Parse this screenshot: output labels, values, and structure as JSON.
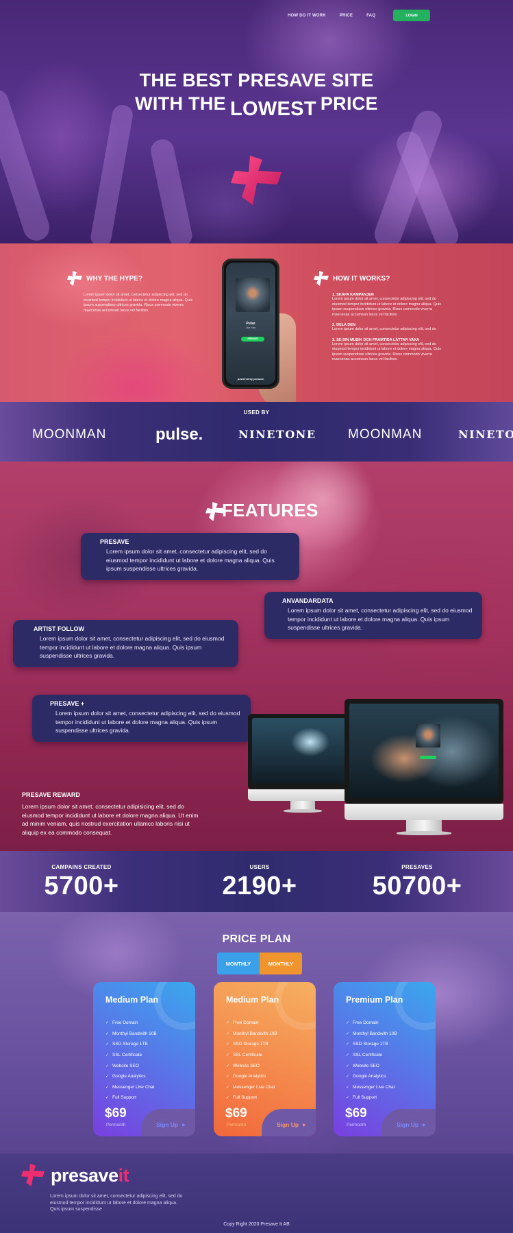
{
  "nav": {
    "links": [
      "HOW DO IT WORK",
      "PRICE",
      "FAQ"
    ],
    "login": "LOGIN"
  },
  "hero": {
    "line1": "THE BEST PRESAVE SITE",
    "line2_a": "WITH THE",
    "line2_b": "LOWEST",
    "line2_c": "PRICE"
  },
  "hype": {
    "title": "WHY THE HYPE?",
    "text": "Lorem ipsum dolor sit amet, consectetur adipiscing elit, sed do eiusmod tempor incididunt ut labore et dolore magna aliqua. Quis ipsum suspendisse ultrices gravida. Risus commodo viverra maecenas accumsan lacus vel facilisis."
  },
  "phone": {
    "artist": "Pulse",
    "subtitle": "Live Now",
    "button": "PRESAVE",
    "footer": "powered by presave"
  },
  "how": {
    "title": "HOW IT WORKS?",
    "steps": [
      {
        "title": "1. SKAPA KAMPANJEN",
        "text": "Lorem ipsum dolor sit amet, consectetur adipiscing elit, sed do eiusmod tempor incididunt ut labore et dolore magna aliqua. Quis ipsum suspendisse ultrices gravida. Risus commodo viverra maecenas accumsan lacus vel facilisis."
      },
      {
        "title": "2. DELA DEN",
        "text": "Lorem ipsum dolor sit amet, consectetur adipiscing elit, sed do"
      },
      {
        "title": "3. SE DIN MUSIK OCH FRAMTIDA LÅTTAR VAXA",
        "text": "Lorem ipsum dolor sit amet, consectetur adipiscing elit, sed do eiusmod tempor incididunt ut labore et dolore magna aliqua. Quis ipsum suspendisse ultrices gravida. Risus commodo viverra maecenas accumsan lacus vel facilisis."
      }
    ]
  },
  "usedby": {
    "title": "USED BY",
    "logos": [
      "MOONMAN",
      "pulse.",
      "NINETONE",
      "MOONMAN",
      "NINETO"
    ]
  },
  "features": {
    "title": "FEATURES",
    "cards": [
      {
        "title": "PRESAVE",
        "text": "Lorem ipsum dolor sit amet, consectetur adipiscing elit, sed do eiusmod tempor incididunt ut labore et dolore magna aliqua. Quis ipsum suspendisse ultrices gravida."
      },
      {
        "title": "ANVANDARDATA",
        "text": "Lorem ipsum dolor sit amet, consectetur adipiscing elit, sed do eiusmod tempor incididunt ut labore et dolore magna aliqua. Quis ipsum suspendisse ultrices gravida."
      },
      {
        "title": "ARTIST FOLLOW",
        "text": "Lorem ipsum dolor sit amet, consectetur adipiscing elit, sed do eiusmod tempor incididunt ut labore et dolore magna aliqua. Quis ipsum suspendisse ultrices gravida."
      },
      {
        "title": "PRESAVE +",
        "text": "Lorem ipsum dolor sit amet, consectetur adipiscing elit, sed do eiusmod tempor incididunt ut labore et dolore magna aliqua. Quis ipsum suspendisse ultrices gravida."
      }
    ],
    "reward_title": "PRESAVE REWARD",
    "reward_text": "Lorem ipsum dolor sit amet, consectetur adipisicing elit, sed do eiusmod tempor incididunt ut labore et dolore magna aliqua. Ut enim ad minim veniam, quis nostrud exercitation ullamco laboris nisi ut aliquip ex ea commodo consequat."
  },
  "stats": [
    {
      "label": "CAMPAINS CREATED",
      "value": "5700+"
    },
    {
      "label": "USERS",
      "value": "2190+"
    },
    {
      "label": "PRESAVES",
      "value": "50700+"
    }
  ],
  "pricing": {
    "title": "PRICE PLAN",
    "toggle": [
      "MONTHLY",
      "MONTHLY"
    ],
    "plans": [
      {
        "name": "Medium Plan",
        "price": "$69",
        "per": "Permonth",
        "signup": "Sign Up",
        "color_from": "#3aa8ee",
        "color_to": "#7a3fe0",
        "accent": "#7a5af0"
      },
      {
        "name": "Medium Plan",
        "price": "$69",
        "per": "Permonth",
        "signup": "Sign Up",
        "color_from": "#f2683c",
        "color_to": "#f6b060",
        "accent": "#f08a5a"
      },
      {
        "name": "Premium Plan",
        "price": "$69",
        "per": "Permonth",
        "signup": "Sign Up",
        "color_from": "#3aa8ee",
        "color_to": "#7a3fe0",
        "accent": "#7a5af0"
      }
    ],
    "features": [
      "Free Domain",
      "Monthyl Bandwith 10B",
      "SSD Storage 1TB",
      "SSL Certificate",
      "Website SEO",
      "Google Analytics",
      "Messenger Live Chat",
      "Full Support"
    ]
  },
  "footer": {
    "logo_main": "presave",
    "logo_accent": "it",
    "text": "Lorem ipsum dolor sit amet, consectetur adipiscing elit, sed do eiusmod tempor incididunt ut labore et dolore magna aliqua. Quis ipsum suspendisse",
    "copyright": "Copy Right 2020 Presave It AB"
  },
  "colors": {
    "brand_pink": "#ee2f6f",
    "login_green": "#23b15f",
    "card_navy": "#2d2b66"
  }
}
